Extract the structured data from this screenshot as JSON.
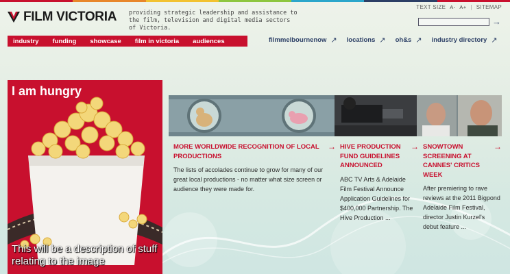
{
  "brand": {
    "logo_text": "FILM VICTORIA",
    "tagline": "providing strategic leadership and assistance to the film, television and digital media sectors of Victoria.",
    "stripe_colors": [
      "#c8102e",
      "#e8862a",
      "#f2c230",
      "#8dc63f",
      "#2ba6cb",
      "#2c3f66",
      "#c8102e"
    ]
  },
  "utility": {
    "text_size_label": "TEXT SIZE",
    "size_small": "A-",
    "size_large": "A+",
    "separator": "|",
    "sitemap": "SITEMAP"
  },
  "search": {
    "value": "",
    "placeholder": ""
  },
  "nav": {
    "items": [
      {
        "label": "industry"
      },
      {
        "label": "funding"
      },
      {
        "label": "showcase"
      },
      {
        "label": "film in victoria"
      },
      {
        "label": "audiences"
      }
    ]
  },
  "quick_links": [
    {
      "label": "filmmelbournenow"
    },
    {
      "label": "locations"
    },
    {
      "label": "oh&s"
    },
    {
      "label": "industry directory"
    }
  ],
  "feature": {
    "title": "I am hungry",
    "caption": "This will be a description of stuff relating to the image"
  },
  "stories": [
    {
      "title": "MORE WORLDWIDE RECOGNITION OF LOCAL PRODUCTIONS",
      "body": "The lists of accolades continue to grow for many of our great local productions - no matter what size screen or audience they were made for."
    },
    {
      "title": "HIVE PRODUCTION FUND GUIDELINES ANNOUNCED",
      "body": "ABC TV Arts & Adelaide Film Festival Announce Application Guidelines for $400,000 Partnership. The Hive Production ..."
    },
    {
      "title": "SNOWTOWN SCREENING AT CANNES' CRITICS WEEK",
      "body": "After premiering to rave reviews at the 2011 Bigpond Adelaide Film Festival, director Justin Kurzel's debut feature ..."
    }
  ],
  "colors": {
    "brand_red": "#c8102e",
    "navy": "#2c3f66"
  }
}
